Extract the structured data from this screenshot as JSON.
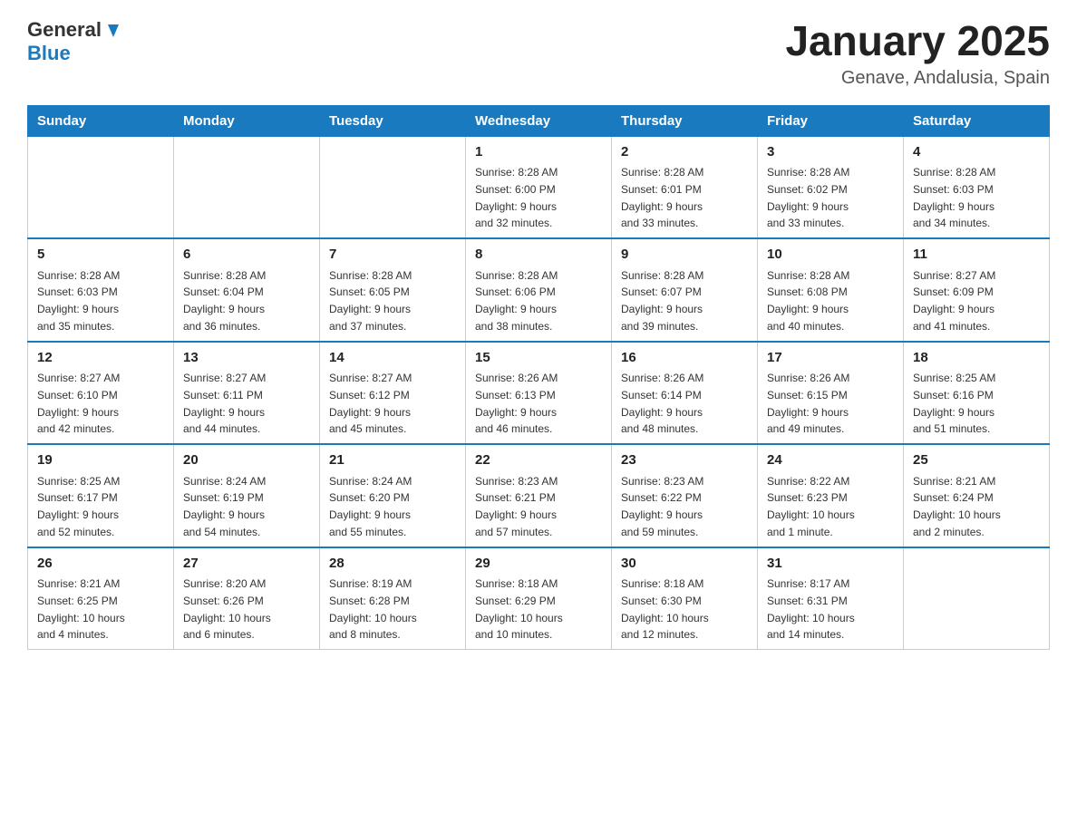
{
  "header": {
    "logo_general": "General",
    "logo_blue": "Blue",
    "title": "January 2025",
    "subtitle": "Genave, Andalusia, Spain"
  },
  "days_of_week": [
    "Sunday",
    "Monday",
    "Tuesday",
    "Wednesday",
    "Thursday",
    "Friday",
    "Saturday"
  ],
  "weeks": [
    [
      {
        "day": "",
        "info": ""
      },
      {
        "day": "",
        "info": ""
      },
      {
        "day": "",
        "info": ""
      },
      {
        "day": "1",
        "info": "Sunrise: 8:28 AM\nSunset: 6:00 PM\nDaylight: 9 hours\nand 32 minutes."
      },
      {
        "day": "2",
        "info": "Sunrise: 8:28 AM\nSunset: 6:01 PM\nDaylight: 9 hours\nand 33 minutes."
      },
      {
        "day": "3",
        "info": "Sunrise: 8:28 AM\nSunset: 6:02 PM\nDaylight: 9 hours\nand 33 minutes."
      },
      {
        "day": "4",
        "info": "Sunrise: 8:28 AM\nSunset: 6:03 PM\nDaylight: 9 hours\nand 34 minutes."
      }
    ],
    [
      {
        "day": "5",
        "info": "Sunrise: 8:28 AM\nSunset: 6:03 PM\nDaylight: 9 hours\nand 35 minutes."
      },
      {
        "day": "6",
        "info": "Sunrise: 8:28 AM\nSunset: 6:04 PM\nDaylight: 9 hours\nand 36 minutes."
      },
      {
        "day": "7",
        "info": "Sunrise: 8:28 AM\nSunset: 6:05 PM\nDaylight: 9 hours\nand 37 minutes."
      },
      {
        "day": "8",
        "info": "Sunrise: 8:28 AM\nSunset: 6:06 PM\nDaylight: 9 hours\nand 38 minutes."
      },
      {
        "day": "9",
        "info": "Sunrise: 8:28 AM\nSunset: 6:07 PM\nDaylight: 9 hours\nand 39 minutes."
      },
      {
        "day": "10",
        "info": "Sunrise: 8:28 AM\nSunset: 6:08 PM\nDaylight: 9 hours\nand 40 minutes."
      },
      {
        "day": "11",
        "info": "Sunrise: 8:27 AM\nSunset: 6:09 PM\nDaylight: 9 hours\nand 41 minutes."
      }
    ],
    [
      {
        "day": "12",
        "info": "Sunrise: 8:27 AM\nSunset: 6:10 PM\nDaylight: 9 hours\nand 42 minutes."
      },
      {
        "day": "13",
        "info": "Sunrise: 8:27 AM\nSunset: 6:11 PM\nDaylight: 9 hours\nand 44 minutes."
      },
      {
        "day": "14",
        "info": "Sunrise: 8:27 AM\nSunset: 6:12 PM\nDaylight: 9 hours\nand 45 minutes."
      },
      {
        "day": "15",
        "info": "Sunrise: 8:26 AM\nSunset: 6:13 PM\nDaylight: 9 hours\nand 46 minutes."
      },
      {
        "day": "16",
        "info": "Sunrise: 8:26 AM\nSunset: 6:14 PM\nDaylight: 9 hours\nand 48 minutes."
      },
      {
        "day": "17",
        "info": "Sunrise: 8:26 AM\nSunset: 6:15 PM\nDaylight: 9 hours\nand 49 minutes."
      },
      {
        "day": "18",
        "info": "Sunrise: 8:25 AM\nSunset: 6:16 PM\nDaylight: 9 hours\nand 51 minutes."
      }
    ],
    [
      {
        "day": "19",
        "info": "Sunrise: 8:25 AM\nSunset: 6:17 PM\nDaylight: 9 hours\nand 52 minutes."
      },
      {
        "day": "20",
        "info": "Sunrise: 8:24 AM\nSunset: 6:19 PM\nDaylight: 9 hours\nand 54 minutes."
      },
      {
        "day": "21",
        "info": "Sunrise: 8:24 AM\nSunset: 6:20 PM\nDaylight: 9 hours\nand 55 minutes."
      },
      {
        "day": "22",
        "info": "Sunrise: 8:23 AM\nSunset: 6:21 PM\nDaylight: 9 hours\nand 57 minutes."
      },
      {
        "day": "23",
        "info": "Sunrise: 8:23 AM\nSunset: 6:22 PM\nDaylight: 9 hours\nand 59 minutes."
      },
      {
        "day": "24",
        "info": "Sunrise: 8:22 AM\nSunset: 6:23 PM\nDaylight: 10 hours\nand 1 minute."
      },
      {
        "day": "25",
        "info": "Sunrise: 8:21 AM\nSunset: 6:24 PM\nDaylight: 10 hours\nand 2 minutes."
      }
    ],
    [
      {
        "day": "26",
        "info": "Sunrise: 8:21 AM\nSunset: 6:25 PM\nDaylight: 10 hours\nand 4 minutes."
      },
      {
        "day": "27",
        "info": "Sunrise: 8:20 AM\nSunset: 6:26 PM\nDaylight: 10 hours\nand 6 minutes."
      },
      {
        "day": "28",
        "info": "Sunrise: 8:19 AM\nSunset: 6:28 PM\nDaylight: 10 hours\nand 8 minutes."
      },
      {
        "day": "29",
        "info": "Sunrise: 8:18 AM\nSunset: 6:29 PM\nDaylight: 10 hours\nand 10 minutes."
      },
      {
        "day": "30",
        "info": "Sunrise: 8:18 AM\nSunset: 6:30 PM\nDaylight: 10 hours\nand 12 minutes."
      },
      {
        "day": "31",
        "info": "Sunrise: 8:17 AM\nSunset: 6:31 PM\nDaylight: 10 hours\nand 14 minutes."
      },
      {
        "day": "",
        "info": ""
      }
    ]
  ]
}
